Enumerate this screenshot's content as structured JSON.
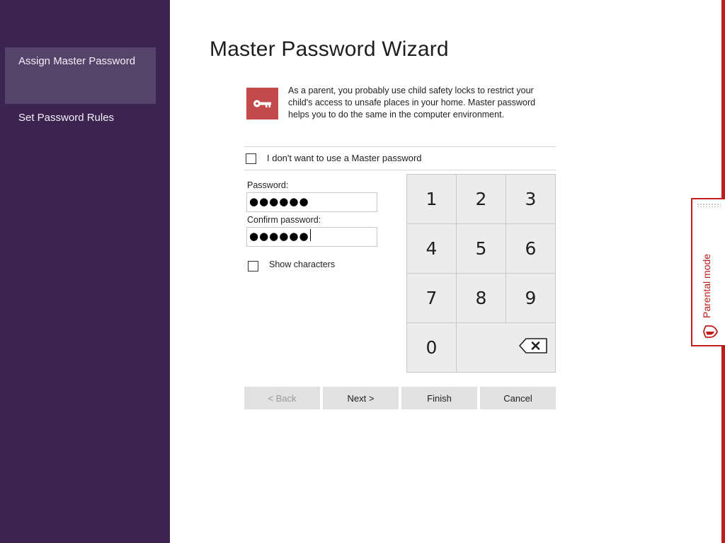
{
  "sidebar": {
    "items": [
      {
        "label": "Assign Master Password",
        "active": true
      },
      {
        "label": "Set Password Rules",
        "active": false
      }
    ]
  },
  "main": {
    "title": "Master Password Wizard",
    "intro": "As a parent, you probably use child safety locks to restrict your child's access to unsafe places in your home. Master password helps you to do the same in the computer environment.",
    "key_icon": "key-icon",
    "no_master_checkbox": {
      "label": "I don't want to use a Master password",
      "checked": false
    },
    "password": {
      "label": "Password:",
      "value": "●●●●●●"
    },
    "confirm_password": {
      "label": "Confirm password:",
      "value": "●●●●●●"
    },
    "show_characters": {
      "label": "Show characters",
      "checked": false
    }
  },
  "keypad": {
    "keys": [
      "1",
      "2",
      "3",
      "4",
      "5",
      "6",
      "7",
      "8",
      "9",
      "0"
    ],
    "backspace_icon": "backspace-icon"
  },
  "buttons": {
    "back": "< Back",
    "next": "Next >",
    "finish": "Finish",
    "cancel": "Cancel"
  },
  "parental_mode": {
    "label": "Parental mode",
    "icon": "shield-icon"
  },
  "colors": {
    "sidebar_bg": "#3b2550",
    "sidebar_active": "#56436a",
    "accent_red": "#c01c1c",
    "key_icon_bg": "#c24a4a"
  }
}
